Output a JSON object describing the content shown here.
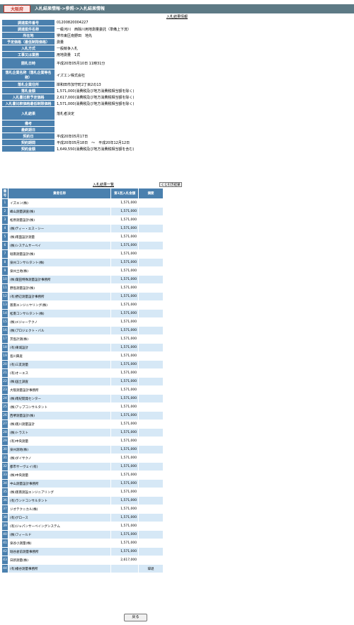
{
  "header": {
    "prefecture": "大阪府",
    "breadcrumb": "入札結果情報->参照->入札結果情報"
  },
  "info_title": "入札結果情報",
  "info": [
    {
      "label": "調達案件番号",
      "value": "01200820004227"
    },
    {
      "label": "調達案件名称",
      "value": "一級河川　西除川用地測量委託（準備上下流）"
    },
    {
      "label": "所在地",
      "value": "堺市東区南野田　地先"
    },
    {
      "label": "予定価格（最低制限価格）",
      "value": "測量"
    },
    {
      "label": "入札方式",
      "value": "一般競争入札"
    },
    {
      "label": "工事又は業務",
      "value": "用地測量　1式"
    },
    {
      "label": "開札日時",
      "value": "平成20年05月10日 11時31分"
    },
    {
      "label": "落札企業名称（落札企業等名称）",
      "value": "イズエン株式会社"
    },
    {
      "label": "落札企業住所",
      "value": "岸和田市加守町2丁目2の13"
    },
    {
      "label": "落札金額",
      "value": "1,571,000(消費税及び地方消費税相当額を除く)"
    },
    {
      "label": "入札書比較予定価格",
      "value": "2,617,000(消費税及び地方消費税相当額を除く)"
    },
    {
      "label": "入札書比較価格最低制限価格",
      "value": "1,571,000(消費税及び地方消費税相当額を除く)"
    },
    {
      "label": "入札結果",
      "value": "落札者決定"
    },
    {
      "label": "備考",
      "value": ""
    },
    {
      "label": "最終期日",
      "value": ""
    },
    {
      "label": "契約日",
      "value": "平成20年05月17日"
    },
    {
      "label": "契約期間",
      "value": "平成20年05月18日　～　平成20年12月12日"
    },
    {
      "label": "契約金額",
      "value": "1,649,550(消費税及び地方消費税相当額を含む)"
    }
  ],
  "results_title": "入札結果一覧",
  "lots_button": "くじ引き結果",
  "results_headers": {
    "no": "番号",
    "name": "業者名称",
    "amount": "第1回入札金額",
    "note": "摘要"
  },
  "results": [
    {
      "no": "1",
      "name": "イズエン(株)",
      "amount": "1,571,000",
      "note": ""
    },
    {
      "no": "2",
      "name": "峰山測量調査(株)",
      "amount": "1,571,000",
      "note": ""
    },
    {
      "no": "3",
      "name": "松原測量設計(株)",
      "amount": "1,571,000",
      "note": ""
    },
    {
      "no": "4",
      "name": "(株)ティー・エス・シー",
      "amount": "1,571,000",
      "note": ""
    },
    {
      "no": "5",
      "name": "(株)南面設計測量",
      "amount": "1,571,000",
      "note": ""
    },
    {
      "no": "6",
      "name": "(株)システムサーベイ",
      "amount": "1,571,000",
      "note": ""
    },
    {
      "no": "7",
      "name": "堀南測量設計(株)",
      "amount": "1,571,000",
      "note": ""
    },
    {
      "no": "8",
      "name": "泉州コンサルタント(株)",
      "amount": "1,571,000",
      "note": ""
    },
    {
      "no": "9",
      "name": "泉州土地(株)",
      "amount": "1,571,000",
      "note": ""
    },
    {
      "no": "10",
      "name": "(株)葉田特殊測量設計事務所",
      "amount": "1,571,000",
      "note": ""
    },
    {
      "no": "11",
      "name": "野島測量設計(株)",
      "amount": "1,571,000",
      "note": ""
    },
    {
      "no": "12",
      "name": "(有)野辺測量設計事務所",
      "amount": "1,571,000",
      "note": ""
    },
    {
      "no": "13",
      "name": "阪南エンジニヤリング(株)",
      "amount": "1,571,000",
      "note": ""
    },
    {
      "no": "14",
      "name": "松南コンサルタント(株)",
      "amount": "1,571,000",
      "note": ""
    },
    {
      "no": "15",
      "name": "(株)メジャーテクノ",
      "amount": "1,571,000",
      "note": ""
    },
    {
      "no": "16",
      "name": "(株)プロジェクト・バル",
      "amount": "1,571,000",
      "note": ""
    },
    {
      "no": "17",
      "name": "茨島計測(株)",
      "amount": "1,571,000",
      "note": ""
    },
    {
      "no": "18",
      "name": "(有)東城設計",
      "amount": "1,571,000",
      "note": ""
    },
    {
      "no": "19",
      "name": "島川興産",
      "amount": "1,571,000",
      "note": ""
    },
    {
      "no": "20",
      "name": "(有)三友測量",
      "amount": "1,571,000",
      "note": ""
    },
    {
      "no": "21",
      "name": "(有)オーエス",
      "amount": "1,571,000",
      "note": ""
    },
    {
      "no": "22",
      "name": "(株)国土調査",
      "amount": "1,571,000",
      "note": ""
    },
    {
      "no": "23",
      "name": "大阪測量設計事務所",
      "amount": "1,571,000",
      "note": ""
    },
    {
      "no": "24",
      "name": "(株)南紀開発センター",
      "amount": "1,571,000",
      "note": ""
    },
    {
      "no": "25",
      "name": "(株)アップコンサルタント",
      "amount": "1,571,000",
      "note": ""
    },
    {
      "no": "26",
      "name": "西堺測量設計(株)",
      "amount": "1,571,000",
      "note": ""
    },
    {
      "no": "27",
      "name": "(株)阪川測量設計",
      "amount": "1,571,000",
      "note": ""
    },
    {
      "no": "28",
      "name": "(株)トラスト",
      "amount": "1,571,000",
      "note": ""
    },
    {
      "no": "29",
      "name": "(有)中央測量",
      "amount": "1,571,000",
      "note": ""
    },
    {
      "no": "30",
      "name": "泉州測地(株)",
      "amount": "1,571,000",
      "note": ""
    },
    {
      "no": "31",
      "name": "(株)ダイサクノ",
      "amount": "1,571,000",
      "note": ""
    },
    {
      "no": "32",
      "name": "都市サーヴェイ(有)",
      "amount": "1,571,000",
      "note": ""
    },
    {
      "no": "33",
      "name": "(株)中央測量",
      "amount": "1,571,000",
      "note": ""
    },
    {
      "no": "34",
      "name": "中山測量設計事務所",
      "amount": "1,571,000",
      "note": ""
    },
    {
      "no": "35",
      "name": "(株)阪南測設エンジニアリング",
      "amount": "1,571,000",
      "note": ""
    },
    {
      "no": "36",
      "name": "(有)ランドコンサルタント",
      "amount": "1,571,000",
      "note": ""
    },
    {
      "no": "37",
      "name": "ジオテクニカル(株)",
      "amount": "1,571,000",
      "note": ""
    },
    {
      "no": "38",
      "name": "(有)グロース",
      "amount": "1,571,000",
      "note": ""
    },
    {
      "no": "39",
      "name": "(有)ジャパンサーベイングシステム",
      "amount": "1,571,000",
      "note": ""
    },
    {
      "no": "40",
      "name": "(株)フィールド",
      "amount": "1,571,000",
      "note": ""
    },
    {
      "no": "41",
      "name": "泉谷小測量(株)",
      "amount": "1,571,000",
      "note": ""
    },
    {
      "no": "42",
      "name": "堀谷倉前測量事務所",
      "amount": "1,571,000",
      "note": ""
    },
    {
      "no": "43",
      "name": "日新測量(株)",
      "amount": "2,617,000",
      "note": ""
    },
    {
      "no": "44",
      "name": "(有)播谷測量事務所",
      "amount": "",
      "note": "辞退"
    }
  ],
  "back_button": "戻る"
}
